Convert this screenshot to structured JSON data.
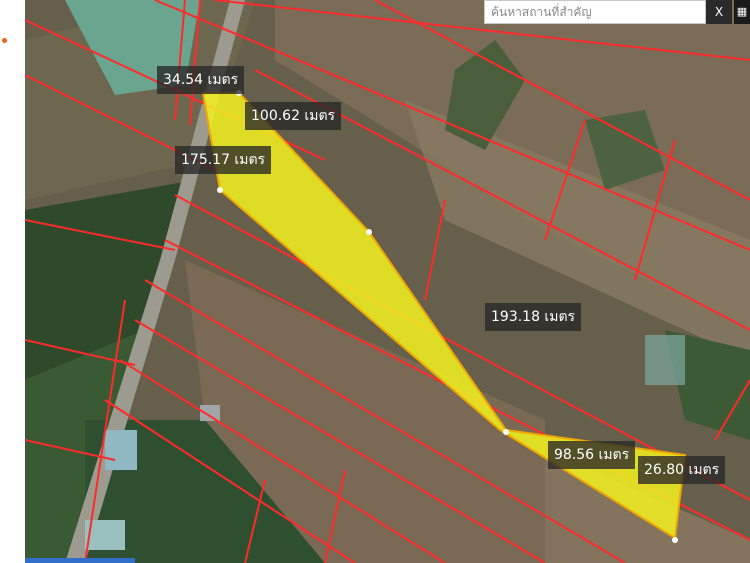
{
  "search": {
    "placeholder": "ค้นหาสถานที่สำคัญ",
    "close_label": "X"
  },
  "measurements": [
    {
      "id": "a",
      "text": "34.54 เมตร"
    },
    {
      "id": "b",
      "text": "100.62 เมตร"
    },
    {
      "id": "c",
      "text": "175.17 เมตร"
    },
    {
      "id": "d",
      "text": "193.18 เมตร"
    },
    {
      "id": "e",
      "text": "98.56 เมตร"
    },
    {
      "id": "f",
      "text": "26.80 เมตร"
    }
  ],
  "colors": {
    "parcel_fill": "#f3f21f",
    "parcel_edge": "#f0a800",
    "boundary_lines": "#ff2a2a"
  }
}
